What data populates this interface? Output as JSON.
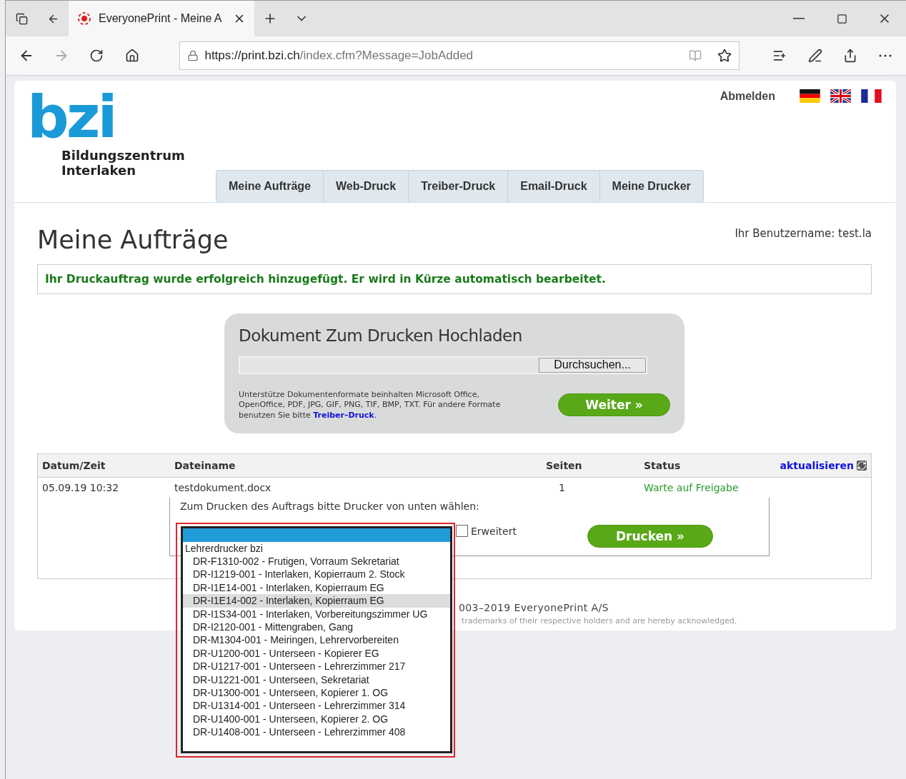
{
  "browser": {
    "tab_title": "EveryonePrint - Meine A",
    "url_host": "https://print.bzi.ch",
    "url_path": "/index.cfm?Message=JobAdded"
  },
  "header": {
    "logo": "bzi",
    "org_lines": [
      "Bildungszentrum",
      "Interlaken"
    ],
    "logout": "Abmelden",
    "flags": [
      {
        "kind": "de"
      },
      {
        "kind": "uk"
      },
      {
        "kind": "fr"
      }
    ]
  },
  "tabs": [
    {
      "label": "Meine Aufträge"
    },
    {
      "label": "Web-Druck"
    },
    {
      "label": "Treiber-Druck"
    },
    {
      "label": "Email-Druck"
    },
    {
      "label": "Meine Drucker"
    }
  ],
  "page_title": "Meine Aufträge",
  "username": "Ihr Benutzername: test.la",
  "message": "Ihr Druckauftrag wurde erfolgreich hinzugefügt. Er wird in Kürze automatisch bearbeitet.",
  "upload": {
    "title": "Dokument Zum Drucken Hochladen",
    "browse_button": "Durchsuchen...",
    "note": "Unterstütze Dokumentenformate beinhalten Microsoft Office, OpenOffice, PDF, JPG, GIF, PNG, TIF, BMP, TXT. Für andere Formate benutzen Sie bitte ",
    "note_link": "Treiber–Druck",
    "note_end": ".",
    "submit": "Weiter »"
  },
  "table": {
    "columns": [
      "Datum/Zeit",
      "Dateiname",
      "Seiten",
      "Status"
    ],
    "refresh": "aktualisieren",
    "rows": [
      {
        "date": "05.09.19 10:32",
        "file": "testdokument.docx",
        "pages": "1",
        "status": "Warte auf Freigabe"
      }
    ]
  },
  "print_panel": {
    "prompt": "Zum Drucken des Auftrags bitte Drucker von unten wählen:",
    "advanced": {
      "label": "Erweitert",
      "checked": false
    },
    "print_button": "Drucken »"
  },
  "dropdown": {
    "empty_option_selected": true,
    "group": "Lehrerdrucker bzi",
    "highlight_frame": true,
    "options": [
      {
        "label": "DR-F1310-002 - Frutigen, Vorraum Sekretariat",
        "highlighted": false
      },
      {
        "label": "DR-I1219-001 - Interlaken, Kopierraum 2. Stock",
        "highlighted": false
      },
      {
        "label": "DR-I1E14-001 - Interlaken, Kopierraum EG",
        "highlighted": false
      },
      {
        "label": "DR-I1E14-002 - Interlaken, Kopierraum EG",
        "highlighted": true
      },
      {
        "label": "DR-I1S34-001 - Interlaken, Vorbereitungszimmer UG",
        "highlighted": false
      },
      {
        "label": "DR-I2120-001 - Mittengraben, Gang",
        "highlighted": false
      },
      {
        "label": "DR-M1304-001 - Meiringen, Lehrervorbereiten",
        "highlighted": false
      },
      {
        "label": "DR-U1200-001 - Unterseen - Kopierer EG",
        "highlighted": false
      },
      {
        "label": "DR-U1217-001 - Unterseen - Lehrerzimmer 217",
        "highlighted": false
      },
      {
        "label": "DR-U1221-001 - Unterseen, Sekretariat",
        "highlighted": false
      },
      {
        "label": "DR-U1300-001 - Unterseen, Kopierer 1. OG",
        "highlighted": false
      },
      {
        "label": "DR-U1314-001 - Unterseen - Lehrerzimmer 314",
        "highlighted": false
      },
      {
        "label": "DR-U1400-001 - Unterseen, Kopierer 2. OG",
        "highlighted": false
      },
      {
        "label": "DR-U1408-001 - Unterseen - Lehrerzimmer 408",
        "highlighted": false
      }
    ]
  },
  "footer": {
    "copyright": "003–2019 EveryonePrint A/S",
    "trademarks": "trademarks of their respective holders and are hereby acknowledged."
  }
}
